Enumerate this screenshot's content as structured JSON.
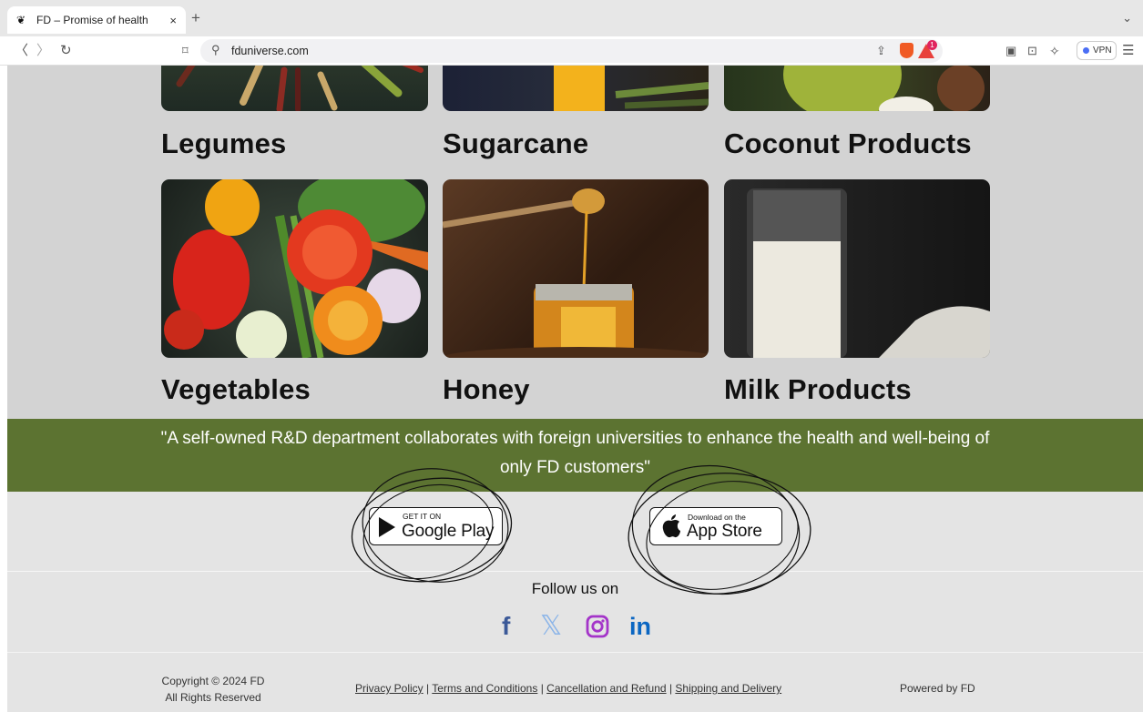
{
  "browser": {
    "tab_title": "FD – Promise of health",
    "tab_close": "×",
    "new_tab": "+",
    "tab_list": "⌄",
    "url": "fduniverse.com",
    "vpn_label": "VPN",
    "bat_badge": "1"
  },
  "categories": [
    {
      "label": "Legumes"
    },
    {
      "label": "Sugarcane"
    },
    {
      "label": "Coconut Products"
    },
    {
      "label": "Vegetables"
    },
    {
      "label": "Honey"
    },
    {
      "label": "Milk Products"
    }
  ],
  "banner": {
    "quote": "\"A self-owned R&D department collaborates with foreign universities to enhance the health and well-being of only FD customers\""
  },
  "stores": {
    "google": {
      "small": "GET IT ON",
      "big": "Google Play"
    },
    "apple": {
      "small": "Download on the",
      "big": "App Store"
    }
  },
  "social": {
    "heading": "Follow us on",
    "icons": [
      "facebook-icon",
      "x-twitter-icon",
      "instagram-icon",
      "linkedin-icon"
    ],
    "colors": {
      "facebook": "#3b5998",
      "x": "#8ab4e8",
      "instagram": "#a434c9",
      "linkedin": "#0a66c2"
    }
  },
  "footer": {
    "copyright_line1": "Copyright © 2024 FD",
    "copyright_line2": "All Rights Reserved",
    "links": [
      "Privacy Policy",
      "Terms and Conditions",
      "Cancellation and Refund",
      "Shipping and Delivery"
    ],
    "separator": "|",
    "powered": "Powered by FD"
  },
  "colors": {
    "banner": "#5c7331",
    "grey_section": "#d3d3d3",
    "page_bg": "#e4e4e4"
  }
}
